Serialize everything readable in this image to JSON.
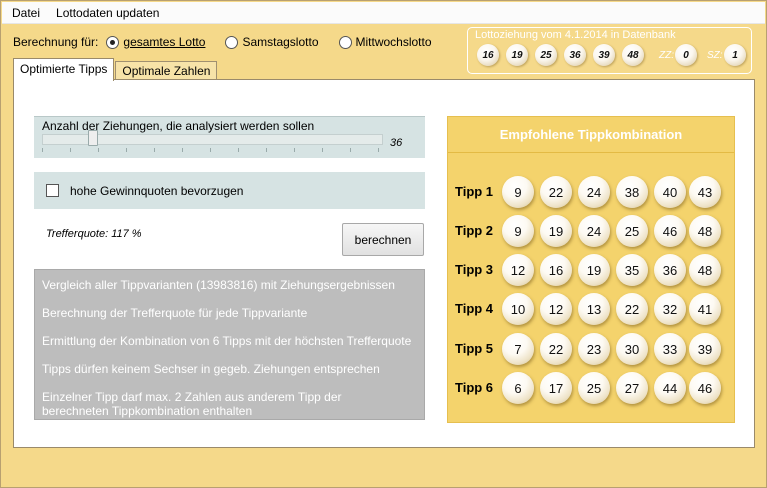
{
  "menu": {
    "items": [
      "Datei",
      "Lottodaten updaten"
    ]
  },
  "calc": {
    "label": "Berechnung für:",
    "options": [
      {
        "label": "gesamtes Lotto",
        "selected": true
      },
      {
        "label": "Samstagslotto",
        "selected": false
      },
      {
        "label": "Mittwochslotto",
        "selected": false
      }
    ]
  },
  "draw": {
    "title": "Lottoziehung vom 4.1.2014 in Datenbank",
    "numbers": [
      "16",
      "19",
      "25",
      "36",
      "39",
      "48"
    ],
    "zz_label": "ZZ:",
    "zz": "0",
    "sz_label": "SZ:",
    "sz": "1"
  },
  "tabs": [
    {
      "label": "Optimierte Tipps",
      "active": true
    },
    {
      "label": "Optimale Zahlen",
      "active": false
    }
  ],
  "analysis": {
    "label": "Anzahl der Ziehungen, die analysiert werden sollen",
    "value": "36",
    "checkbox_label": "hohe Gewinnquoten bevorzugen",
    "checkbox_checked": false,
    "quote": "Trefferquote: 117 %",
    "button": "berechnen"
  },
  "info_lines": [
    "Vergleich aller Tippvarianten (13983816) mit Ziehungsergebnissen",
    "Berechnung der Trefferquote für jede Tippvariante",
    "Ermittlung der Kombination von 6 Tipps mit der höchsten Trefferquote",
    "Tipps dürfen keinem Sechser in gegeb. Ziehungen entsprechen",
    "Einzelner Tipp darf max. 2 Zahlen aus anderem Tipp der",
    "berechneten Tippkombination enthalten"
  ],
  "recommendation": {
    "title": "Empfohlene Tippkombination",
    "tips": [
      {
        "label": "Tipp 1",
        "numbers": [
          "9",
          "22",
          "24",
          "38",
          "40",
          "43"
        ]
      },
      {
        "label": "Tipp 2",
        "numbers": [
          "9",
          "19",
          "24",
          "25",
          "46",
          "48"
        ]
      },
      {
        "label": "Tipp 3",
        "numbers": [
          "12",
          "16",
          "19",
          "35",
          "36",
          "48"
        ]
      },
      {
        "label": "Tipp 4",
        "numbers": [
          "10",
          "12",
          "13",
          "22",
          "32",
          "41"
        ]
      },
      {
        "label": "Tipp 5",
        "numbers": [
          "7",
          "22",
          "23",
          "30",
          "33",
          "39"
        ]
      },
      {
        "label": "Tipp 6",
        "numbers": [
          "6",
          "17",
          "25",
          "27",
          "44",
          "46"
        ]
      }
    ]
  },
  "colors": {
    "window_bg": "#f5d98a",
    "recommend_bg": "#f4d36c",
    "info_bg": "#bdbdbd",
    "option_box_bg": "#d6e3e3"
  }
}
